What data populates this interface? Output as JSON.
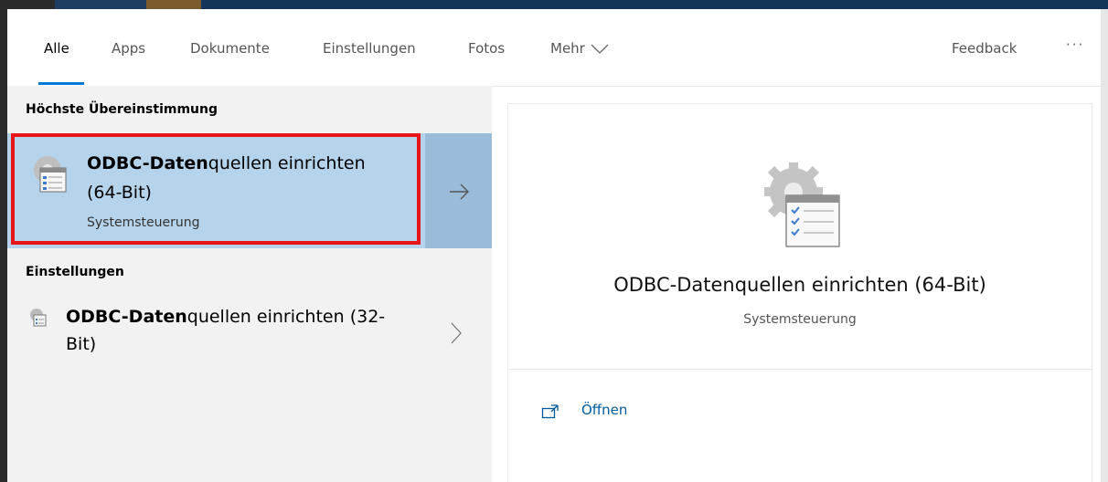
{
  "tabs": [
    {
      "label": "Alle",
      "active": true
    },
    {
      "label": "Apps"
    },
    {
      "label": "Dokumente"
    },
    {
      "label": "Einstellungen"
    },
    {
      "label": "Fotos"
    },
    {
      "label": "Mehr"
    }
  ],
  "feedback_label": "Feedback",
  "more_options_label": "···",
  "best_match": {
    "heading": "Höchste Übereinstimmung",
    "title_bold": "ODBC-Daten",
    "title_rest": "quellen einrichten",
    "title_line2": "(64-Bit)",
    "subtitle": "Systemsteuerung",
    "icon": "odbc-settings-icon"
  },
  "settings": {
    "heading": "Einstellungen",
    "item": {
      "title_bold": "ODBC-Daten",
      "title_rest": "quellen einrichten (32-",
      "title_line2": "Bit)",
      "icon": "odbc-settings-small-icon"
    }
  },
  "preview": {
    "title": "ODBC-Datenquellen einrichten (64-Bit)",
    "subtitle": "Systemsteuerung",
    "open_label": "Öffnen",
    "icon": "odbc-settings-large-icon"
  },
  "colors": {
    "accent": "#0078d7",
    "selection": "#b5d3ea",
    "highlight_box": "#e8151b"
  }
}
